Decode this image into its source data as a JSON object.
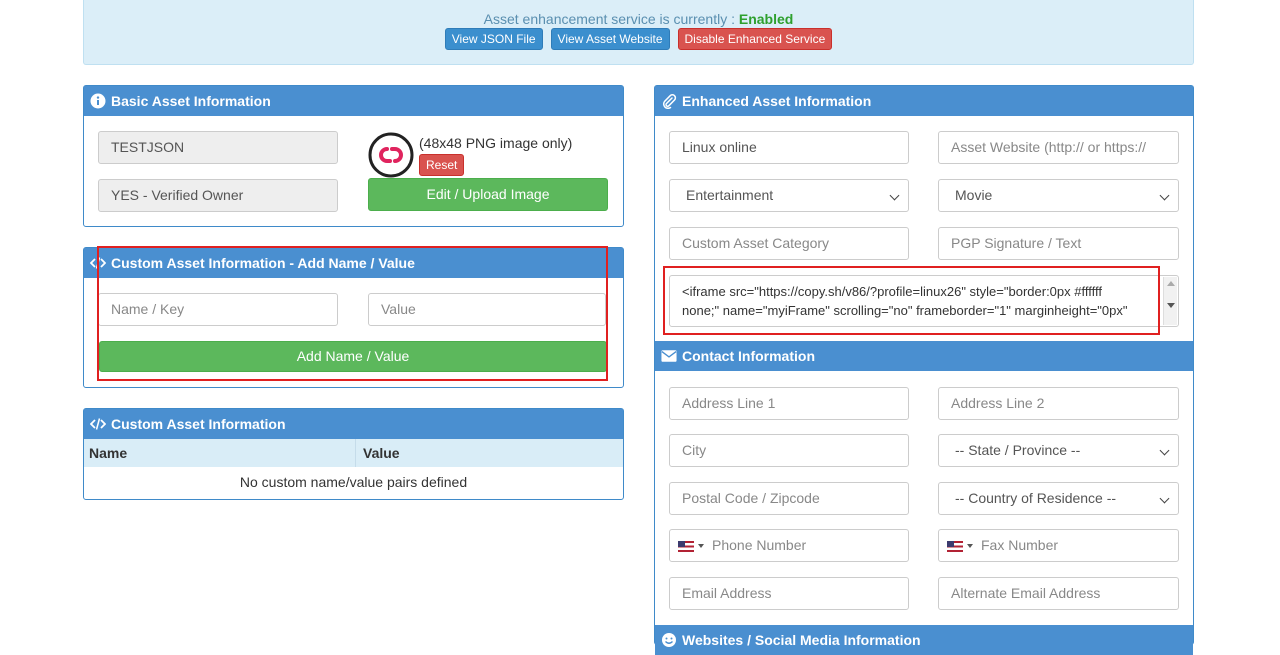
{
  "banner": {
    "status_prefix": "Asset enhancement service is currently :",
    "status_value": "Enabled",
    "view_json": "View JSON File",
    "view_website": "View Asset Website",
    "disable": "Disable Enhanced Service"
  },
  "basic": {
    "title": "Basic Asset Information",
    "asset_name": "TESTJSON",
    "owner_status": "YES - Verified Owner",
    "image_hint": "(48x48 PNG image only)",
    "reset": "Reset",
    "upload": "Edit / Upload Image"
  },
  "custom_add": {
    "title": "Custom Asset Information - Add Name / Value",
    "name_placeholder": "Name / Key",
    "value_placeholder": "Value",
    "add": "Add Name / Value"
  },
  "custom_table": {
    "title": "Custom Asset Information",
    "col_name": "Name",
    "col_value": "Value",
    "empty": "No custom name/value pairs defined"
  },
  "enhanced": {
    "title": "Enhanced Asset Information",
    "display_name": "Linux online",
    "website_placeholder": "Asset Website (http:// or https://",
    "category": "Entertainment",
    "subcategory": "Movie",
    "custom_category_placeholder": "Custom Asset Category",
    "pgp_placeholder": "PGP Signature / Text",
    "embed_line1": "<iframe src=\"https://copy.sh/v86/?profile=linux26\" style=\"border:0px #ffffff",
    "embed_line2": "none;\" name=\"myiFrame\" scrolling=\"no\" frameborder=\"1\" marginheight=\"0px\""
  },
  "contact": {
    "title": "Contact Information",
    "address1": "Address Line 1",
    "address2": "Address Line 2",
    "city": "City",
    "state": "-- State / Province --",
    "postal": "Postal Code / Zipcode",
    "country": "-- Country of Residence --",
    "phone": "Phone Number",
    "fax": "Fax Number",
    "email": "Email Address",
    "alt_email": "Alternate Email Address"
  },
  "websites": {
    "title": "Websites / Social Media Information"
  },
  "colors": {
    "panel_header": "#4a8fd0",
    "enabled": "#2ea02e",
    "highlight": "#e02020",
    "green_button": "#5cb85c"
  }
}
